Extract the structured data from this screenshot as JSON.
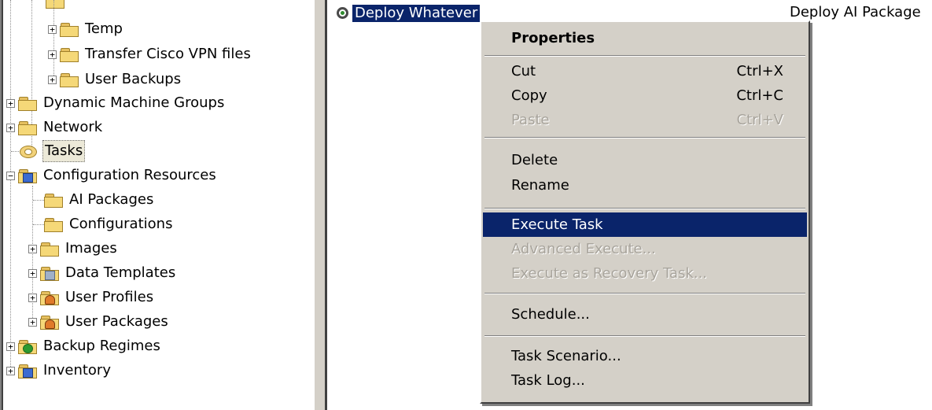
{
  "tree": {
    "items": [
      {
        "label": "Temp",
        "expander": "+"
      },
      {
        "label": "Transfer Cisco VPN files",
        "expander": "+"
      },
      {
        "label": "User Backups",
        "expander": "+"
      },
      {
        "label": "Dynamic Machine Groups",
        "expander": "+"
      },
      {
        "label": "Network",
        "expander": "+"
      },
      {
        "label": "Tasks",
        "expander": ""
      },
      {
        "label": "Configuration Resources",
        "expander": "−"
      },
      {
        "label": "AI Packages",
        "expander": ""
      },
      {
        "label": "Configurations",
        "expander": ""
      },
      {
        "label": "Images",
        "expander": "+"
      },
      {
        "label": "Data Templates",
        "expander": "+"
      },
      {
        "label": "User Profiles",
        "expander": "+"
      },
      {
        "label": "User Packages",
        "expander": "+"
      },
      {
        "label": "Backup Regimes",
        "expander": "+"
      },
      {
        "label": "Inventory",
        "expander": "+"
      }
    ]
  },
  "list": {
    "item_name": "Deploy Whatever",
    "item_type": "Deploy AI Package"
  },
  "menu": {
    "properties": "Properties",
    "cut": "Cut",
    "cut_shortcut": "Ctrl+X",
    "copy": "Copy",
    "copy_shortcut": "Ctrl+C",
    "paste": "Paste",
    "paste_shortcut": "Ctrl+V",
    "delete": "Delete",
    "rename": "Rename",
    "execute_task": "Execute Task",
    "advanced_execute": "Advanced Execute...",
    "execute_recovery": "Execute as Recovery Task...",
    "schedule": "Schedule...",
    "task_scenario": "Task Scenario...",
    "task_log": "Task Log..."
  },
  "colors": {
    "selection": "#0a246a",
    "menu_background": "#d4d0c8",
    "folder": "#f5d878"
  }
}
